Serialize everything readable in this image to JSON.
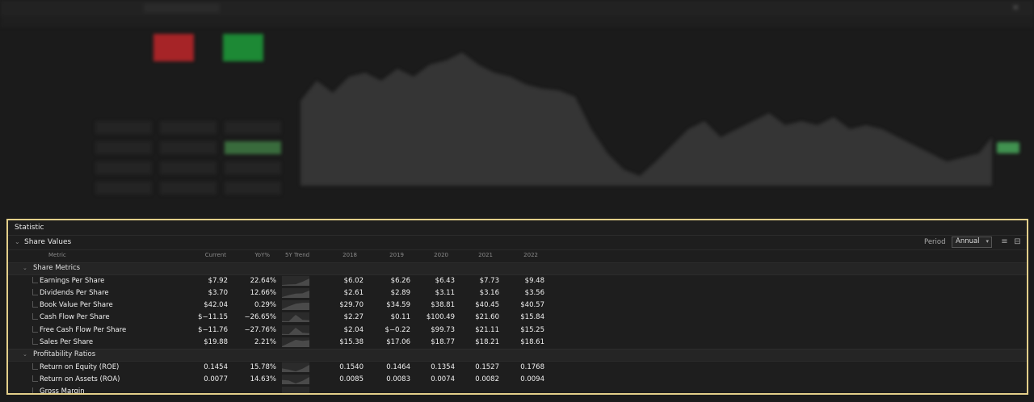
{
  "statistic": {
    "title": "Statistic",
    "section": "Share Values",
    "period_label": "Period",
    "period_value": "Annual",
    "columns": [
      "Metric",
      "Current",
      "YoY%",
      "5Y Trend",
      "2018",
      "2019",
      "2020",
      "2021",
      "2022"
    ],
    "groups": [
      {
        "name": "Share Metrics",
        "rows": [
          {
            "metric": "Earnings Per Share",
            "current": "$7.92",
            "yoy": "22.64%",
            "v": [
              "$6.02",
              "$6.26",
              "$6.43",
              "$7.73",
              "$9.48"
            ],
            "trend": [
              6.02,
              6.26,
              6.43,
              7.73,
              9.48
            ]
          },
          {
            "metric": "Dividends Per Share",
            "current": "$3.70",
            "yoy": "12.66%",
            "v": [
              "$2.61",
              "$2.89",
              "$3.11",
              "$3.16",
              "$3.56"
            ],
            "trend": [
              2.61,
              2.89,
              3.11,
              3.16,
              3.56
            ]
          },
          {
            "metric": "Book Value Per Share",
            "current": "$42.04",
            "yoy": "0.29%",
            "v": [
              "$29.70",
              "$34.59",
              "$38.81",
              "$40.45",
              "$40.57"
            ],
            "trend": [
              29.7,
              34.59,
              38.81,
              40.45,
              40.57
            ]
          },
          {
            "metric": "Cash Flow Per Share",
            "current": "$−11.15",
            "yoy": "−26.65%",
            "v": [
              "$2.27",
              "$0.11",
              "$100.49",
              "$21.60",
              "$15.84"
            ],
            "trend": [
              2.27,
              0.11,
              100.49,
              21.6,
              15.84
            ]
          },
          {
            "metric": "Free Cash Flow Per Share",
            "current": "$−11.76",
            "yoy": "−27.76%",
            "v": [
              "$2.04",
              "$−0.22",
              "$99.73",
              "$21.11",
              "$15.25"
            ],
            "trend": [
              2.04,
              -0.22,
              99.73,
              21.11,
              15.25
            ]
          },
          {
            "metric": "Sales Per Share",
            "current": "$19.88",
            "yoy": "2.21%",
            "v": [
              "$15.38",
              "$17.06",
              "$18.77",
              "$18.21",
              "$18.61"
            ],
            "trend": [
              15.38,
              17.06,
              18.77,
              18.21,
              18.61
            ]
          }
        ]
      },
      {
        "name": "Profitability Ratios",
        "rows": [
          {
            "metric": "Return on Equity (ROE)",
            "current": "0.1454",
            "yoy": "15.78%",
            "v": [
              "0.1540",
              "0.1464",
              "0.1354",
              "0.1527",
              "0.1768"
            ],
            "trend": [
              0.154,
              0.1464,
              0.1354,
              0.1527,
              0.1768
            ]
          },
          {
            "metric": "Return on Assets (ROA)",
            "current": "0.0077",
            "yoy": "14.63%",
            "v": [
              "0.0085",
              "0.0083",
              "0.0074",
              "0.0082",
              "0.0094"
            ],
            "trend": [
              0.0085,
              0.0083,
              0.0074,
              0.0082,
              0.0094
            ]
          },
          {
            "metric": "Gross Margin",
            "current": "",
            "yoy": "",
            "v": [
              "",
              "",
              "",
              "",
              ""
            ],
            "trend": []
          }
        ]
      }
    ]
  },
  "colors": {
    "accent_border": "#e3cf8a",
    "sell": "#c0262a",
    "buy": "#1e9d3a",
    "chart_fill": "#3a3a3a"
  }
}
